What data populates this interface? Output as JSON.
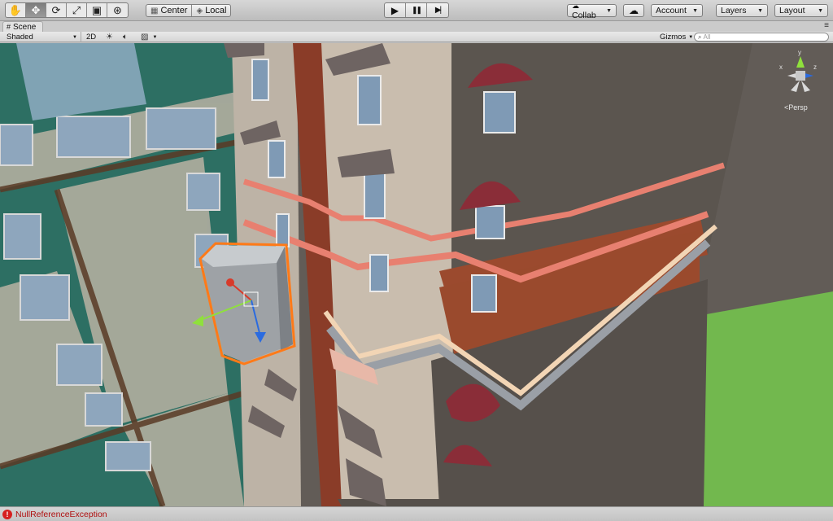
{
  "toolbar": {
    "tools": [
      {
        "name": "hand-tool",
        "icon": "hand-icon",
        "glyph": "✋"
      },
      {
        "name": "move-tool",
        "icon": "move-icon",
        "glyph": "✥"
      },
      {
        "name": "rotate-tool",
        "icon": "rotate-icon",
        "glyph": "⟳"
      },
      {
        "name": "scale-tool",
        "icon": "scale-icon",
        "glyph": "⤢"
      },
      {
        "name": "rect-tool",
        "icon": "rect-icon",
        "glyph": "▣"
      },
      {
        "name": "transform-tool",
        "icon": "transform-icon",
        "glyph": "⊛"
      }
    ],
    "active_tool": "move-tool",
    "pivot_label": "Center",
    "handle_label": "Local",
    "play_icons": {
      "play": "▶",
      "pause": "❚❚",
      "step": "▶|"
    },
    "collab_label": "Collab",
    "account_label": "Account",
    "layers_label": "Layers",
    "layout_label": "Layout"
  },
  "scene_tab": {
    "title": "Scene",
    "menu_glyph": "≡"
  },
  "scene_toolbar": {
    "shading_mode": "Shaded",
    "toggle_2d": "2D",
    "gizmos_label": "Gizmos",
    "search_placeholder": "All"
  },
  "viewport": {
    "projection_label": "Persp",
    "gizmo_axes": {
      "y": "y",
      "z": "z",
      "x": "x"
    },
    "colors": {
      "selection_outline": "#ff7a18",
      "axis_x": "#d83a2a",
      "axis_y": "#8fe03c",
      "axis_z": "#2a6be0",
      "grass": "#6fb34a"
    }
  },
  "status": {
    "message": "NullReferenceException",
    "icon": "error-icon"
  }
}
